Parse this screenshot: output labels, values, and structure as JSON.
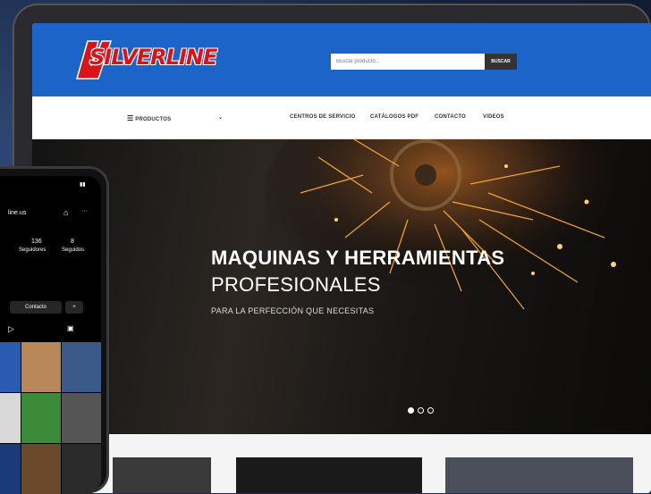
{
  "brand": {
    "name": "SILVERLINE",
    "color": "#d6141a",
    "header_color": "#1c64c7"
  },
  "search": {
    "placeholder": "Buscar producto...",
    "button": "BUSCAR"
  },
  "nav": {
    "products": "PRODUCTOS",
    "items": [
      "CENTROS DE SERVICIO",
      "CATÁLOGOS PDF",
      "CONTACTO",
      "VIDEOS"
    ]
  },
  "hero": {
    "title_line1": "MAQUINAS Y HERRAMIENTAS",
    "title_line2": "PROFESIONALES",
    "subtitle": "PARA LA PERFECCIÓN QUE NECESITAS",
    "slides": 3,
    "active_slide": 1
  },
  "phone": {
    "username": "line.us",
    "posts_count": "136",
    "posts_label": "Seguidores",
    "following_count": "8",
    "following_label": "Seguidos",
    "contact_button": "Contacto"
  }
}
